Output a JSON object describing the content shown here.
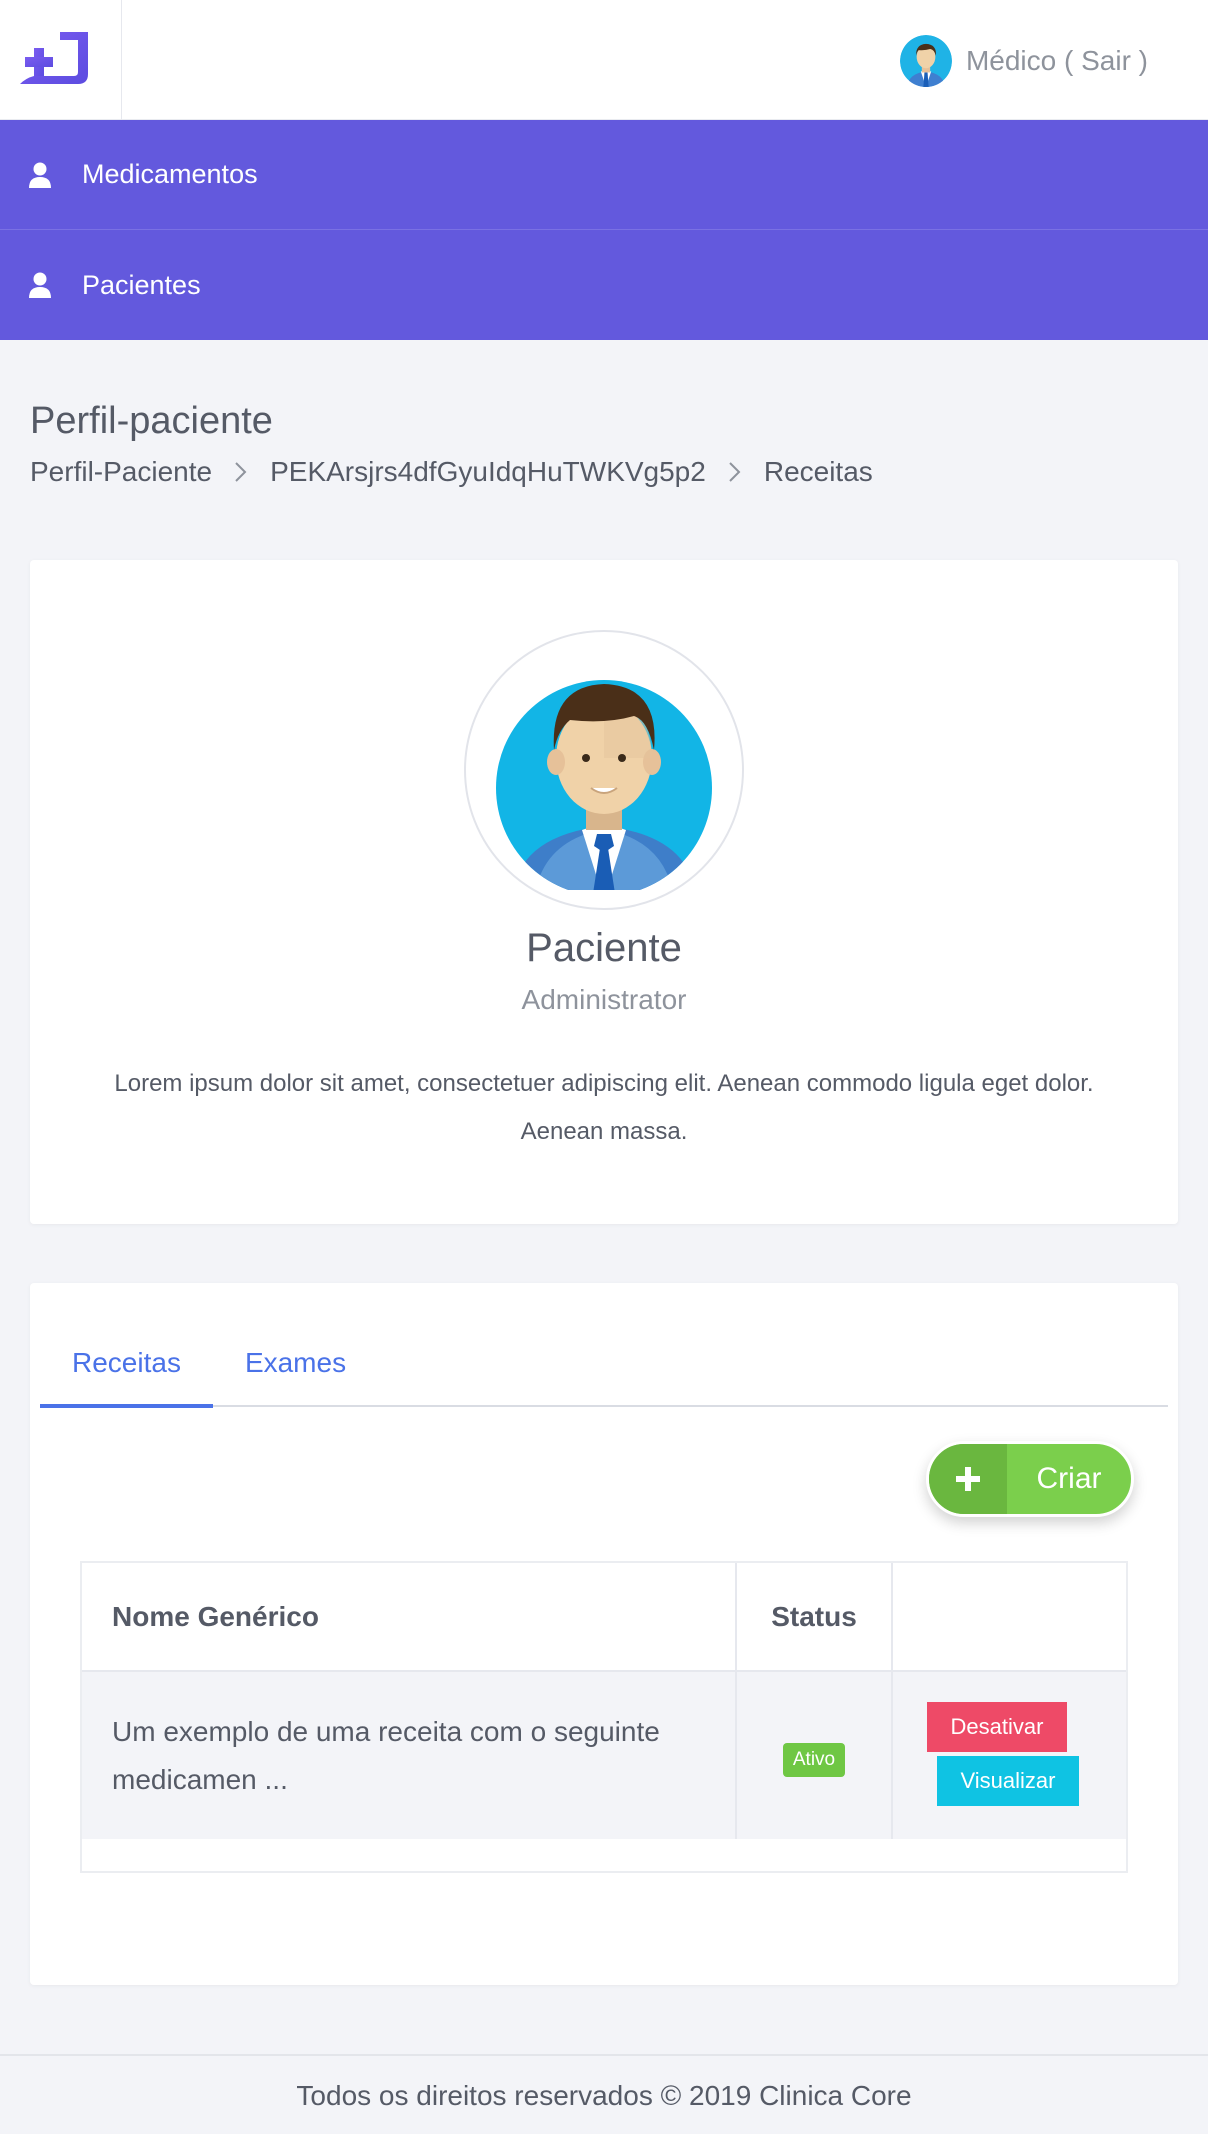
{
  "header": {
    "user_label": "Médico ( Sair )"
  },
  "menu": {
    "items": [
      {
        "label": "Medicamentos",
        "icon": "user-icon"
      },
      {
        "label": "Pacientes",
        "icon": "user-icon"
      }
    ]
  },
  "page": {
    "title": "Perfil-paciente",
    "breadcrumb": [
      "Perfil-Paciente",
      "PEKArsjrs4dfGyuIdqHuTWKVg5p2",
      "Receitas"
    ]
  },
  "profile": {
    "name": "Paciente",
    "role": "Administrator",
    "description": "Lorem ipsum dolor sit amet, consectetuer adipiscing elit. Aenean commodo ligula eget dolor. Aenean massa."
  },
  "tabs": [
    {
      "label": "Receitas",
      "active": true
    },
    {
      "label": "Exames",
      "active": false
    }
  ],
  "create_button": {
    "label": "Criar"
  },
  "table": {
    "headers": [
      "Nome Genérico",
      "Status",
      ""
    ],
    "rows": [
      {
        "name": "Um exemplo de uma receita com o seguinte medicamen ...",
        "status": "Ativo",
        "actions": [
          "Desativar",
          "Visualizar"
        ]
      }
    ]
  },
  "footer": {
    "text": "Todos os direitos reservados © 2019 Clinica Core"
  },
  "colors": {
    "menu_bg": "#6359dd",
    "accent_blue": "#4a72e8",
    "success": "#6fc744",
    "danger": "#ee4a67",
    "info": "#0fc3e3"
  }
}
